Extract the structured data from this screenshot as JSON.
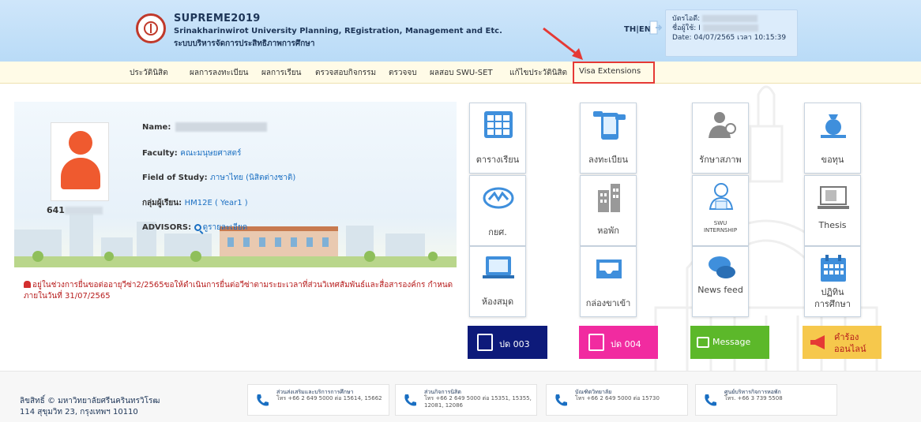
{
  "header": {
    "title": "SUPREME2019",
    "subtitle_en": "Srinakharinwirot University Planning, REgistration, Management and Etc.",
    "subtitle_th": "ระบบบริหารจัดการประสิทธิภาพการศึกษา",
    "lang_th": "TH",
    "lang_sep": "|",
    "lang_en": "EN",
    "user": {
      "id_label": "บัตรไอดี:",
      "name_label": "ชื่อผู้ใช้: I",
      "date_text": "Date: 04/07/2565 เวลา 10:15:39"
    }
  },
  "menu": [
    "ประวัตินิสิต",
    "ผลการลงทะเบียน",
    "ผลการเรียน",
    "ตรวจสอบกิจกรรม",
    "ตรวจจบ",
    "ผลสอบ SWU-SET",
    "แก้ไขประวัตินิสิต",
    "Visa Extensions"
  ],
  "profile": {
    "id_prefix": "641",
    "name_label": "Name:",
    "faculty_label": "Faculty:",
    "faculty_value": "คณะมนุษยศาสตร์",
    "field_label": "Field of Study:",
    "field_value": "ภาษาไทย (นิสิตต่างชาติ)",
    "group_label": "กลุ่มผู้เรียน:",
    "group_value": "HM12E ( Year1 )",
    "advisors_label": "ADVISORS:",
    "advisors_value": "ดูรายละเอียด"
  },
  "notice": {
    "line1": "อยู่ในช่วงการยื่นขอต่ออายุวีซ่า2/2565ขอให้ดำเนินการยื่นต่อวีซ่าตามระยะเวลาที่ส่วนวิเทศสัมพันธ์และสื่อสารองค์กร กำหนด",
    "line2": "ภายในวันที่ 31/07/2565"
  },
  "tiles": {
    "timetable": "ตารางเรียน",
    "register": "ลงทะเบียน",
    "health": "รักษาสภาพ",
    "scholarship": "ขอทุน",
    "loan": "กยศ.",
    "dorm": "หอพัก",
    "internship_1": "SWU",
    "internship_2": "INTERNSHIP",
    "thesis": "Thesis",
    "library": "ห้องสมุด",
    "inbox": "กล่องขาเข้า",
    "news": "News feed",
    "calendar_1": "ปฏิทิน",
    "calendar_2": "การศึกษา"
  },
  "buttons": {
    "pd003": "ปด 003",
    "pd004": "ปด 004",
    "message": "Message",
    "request_1": "คำร้อง",
    "request_2": "ออนไลน์"
  },
  "footer": {
    "copyright": "ลิขสิทธิ์ © มหาวิทยาลัยศรีนครินทรวิโรฒ",
    "address": "114 สุขุมวิท 23, กรุงเทพฯ 10110",
    "contacts": [
      {
        "name": "ส่วนส่งเสริมและบริการการศึกษา",
        "phone": "โทร +66 2 649 5000 ต่อ 15614, 15662"
      },
      {
        "name": "ส่วนกิจการนิสิต",
        "phone": "โทร +66 2 649 5000 ต่อ 15351, 15355, 12081, 12086"
      },
      {
        "name": "บัณฑิตวิทยาลัย",
        "phone": "โทร +66 2 649 5000 ต่อ 15730"
      },
      {
        "name": "ศูนย์บริหารกิจการหอพัก",
        "phone": "โทร. +66 3 739 5508"
      }
    ]
  },
  "colors": {
    "header_bg": "#bfdcf6",
    "menu_bg": "#fffbe7",
    "highlight": "#e53935",
    "pd003": "#0d1a7a",
    "pd004": "#f12ba0",
    "message": "#5cb82a",
    "request": "#f6c84c"
  }
}
